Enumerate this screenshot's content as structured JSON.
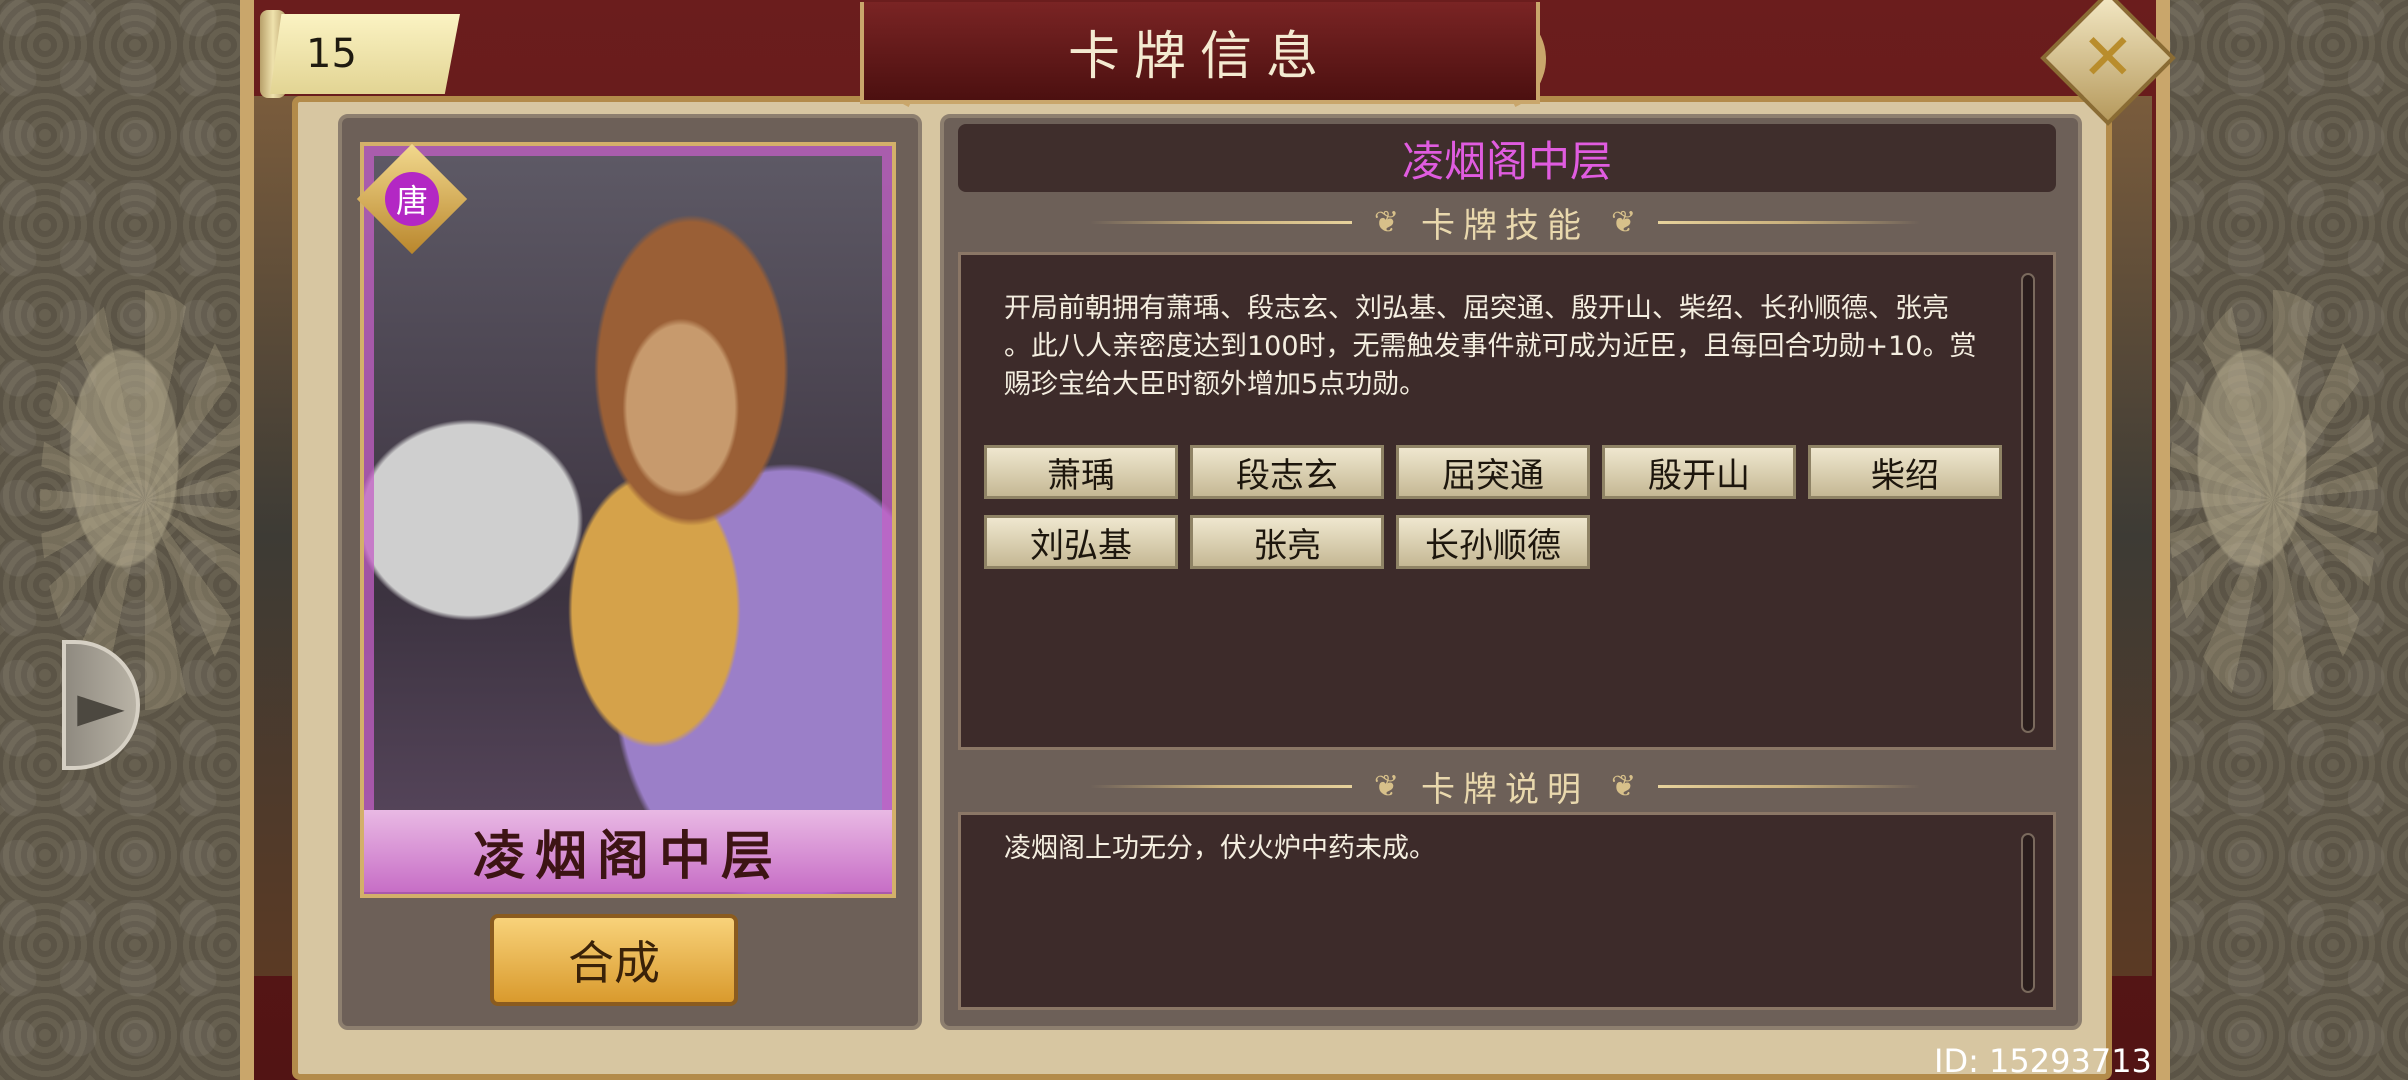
{
  "header": {
    "title": "卡牌信息",
    "level": "15"
  },
  "card": {
    "faction": "唐",
    "name_plate": "凌烟阁中层",
    "combine_label": "合成"
  },
  "info": {
    "card_name": "凌烟阁中层",
    "skill_section_label": "卡牌技能",
    "skill_desc_line1": "开局前朝拥有萧瑀、段志玄、刘弘基、屈突通、殷开山、柴绍、长孙顺德、张亮",
    "skill_desc_line2": "。此八人亲密度达到100时，无需触发事件就可成为近臣，且每回合功勋+10。赏",
    "skill_desc_line3": "赐珍宝给大臣时额外增加5点功勋。",
    "members": [
      "萧瑀",
      "段志玄",
      "屈突通",
      "殷开山",
      "柴绍",
      "刘弘基",
      "张亮",
      "长孙顺德"
    ],
    "lore_section_label": "卡牌说明",
    "lore_text": "凌烟阁上功无分，伏火炉中药未成。"
  },
  "footer": {
    "id_text": "ID: 15293713"
  },
  "icons": {
    "close": "close-icon",
    "nav": "chevron-right-icon"
  },
  "colors": {
    "card_name": "#e05ce0",
    "frame_red": "#6b1d1d",
    "gold": "#c9a66b"
  }
}
